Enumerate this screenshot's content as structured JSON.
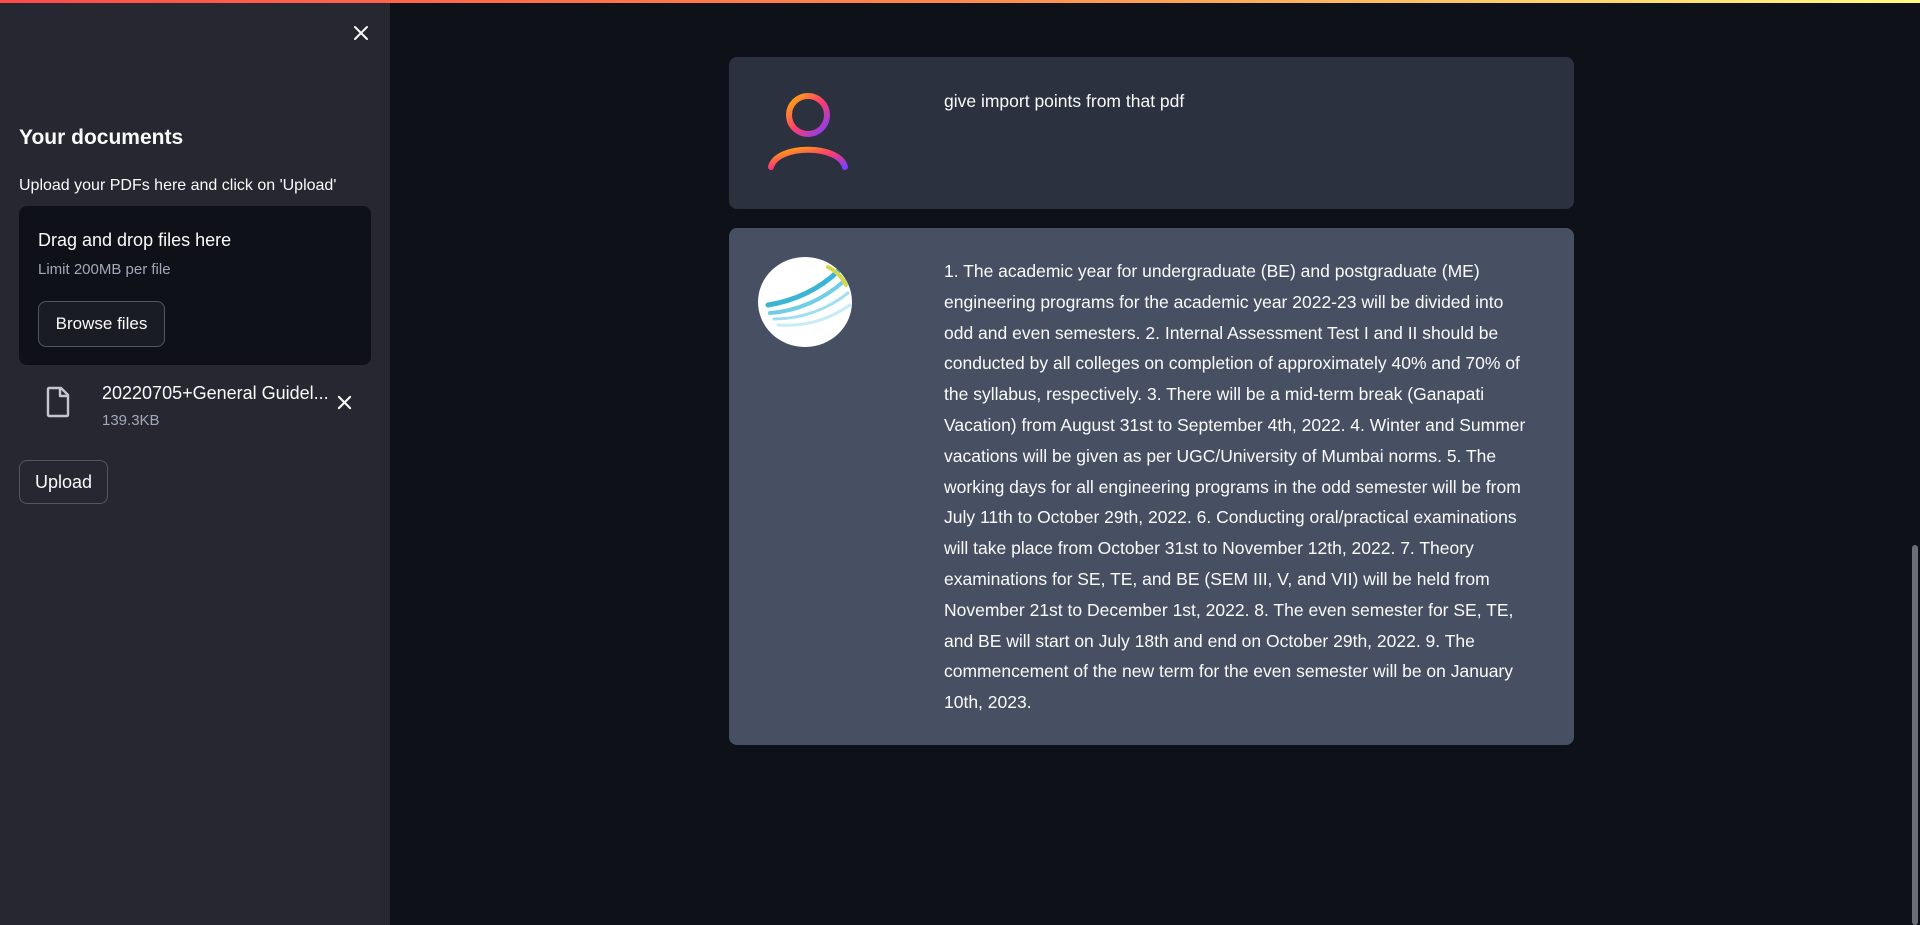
{
  "sidebar": {
    "title": "Your documents",
    "upload_label": "Upload your PDFs here and click on 'Upload'",
    "dropzone": {
      "title": "Drag and drop files here",
      "limit": "Limit 200MB per file",
      "browse_label": "Browse files"
    },
    "file": {
      "name": "20220705+General Guidel...",
      "size": "139.3KB"
    },
    "upload_button": "Upload"
  },
  "chat": {
    "messages": [
      {
        "role": "user",
        "text": "give import points from that pdf"
      },
      {
        "role": "bot",
        "text": "1. The academic year for undergraduate (BE) and postgraduate (ME) engineering programs for the academic year 2022-23 will be divided into odd and even semesters. 2. Internal Assessment Test I and II should be conducted by all colleges on completion of approximately 40% and 70% of the syllabus, respectively. 3. There will be a mid-term break (Ganapati Vacation) from August 31st to September 4th, 2022. 4. Winter and Summer vacations will be given as per UGC/University of Mumbai norms. 5. The working days for all engineering programs in the odd semester will be from July 11th to October 29th, 2022. 6. Conducting oral/practical examinations will take place from October 31st to November 12th, 2022. 7. Theory examinations for SE, TE, and BE (SEM III, V, and VII) will be held from November 21st to December 1st, 2022. 8. The even semester for SE, TE, and BE will start on July 18th and end on October 29th, 2022. 9. The commencement of the new term for the even semester will be on January 10th, 2023."
      }
    ]
  },
  "icons": {
    "sidebar_close": "close-icon",
    "file": "file-icon",
    "file_remove": "close-icon",
    "user_avatar": "user-icon",
    "bot_avatar": "bot-logo"
  },
  "colors": {
    "app_background": "#0e1117",
    "sidebar_background": "#262730",
    "user_message_background": "#2b313e",
    "bot_message_background": "#475063",
    "accent_gradient_start": "#ff4b4b",
    "accent_gradient_end": "#fffd80"
  }
}
